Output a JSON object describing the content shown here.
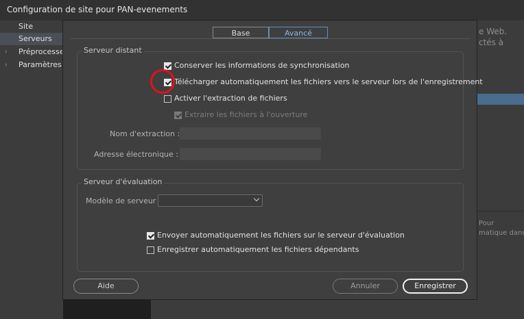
{
  "window": {
    "title": "Configuration de site pour PAN-evenements"
  },
  "outer_sidebar": {
    "items": [
      {
        "label": "Site",
        "selected": false,
        "expandable": false
      },
      {
        "label": "Serveurs",
        "selected": true,
        "expandable": false
      },
      {
        "label": "Préprocesse",
        "selected": false,
        "expandable": true
      },
      {
        "label": "Paramètres a",
        "selected": false,
        "expandable": true
      }
    ]
  },
  "outer_right": {
    "line1": "e Web.",
    "line2": "ctés à",
    "line3": "Pour",
    "line4": "matique dans"
  },
  "dialog": {
    "tabs": [
      {
        "label": "Base",
        "active": false
      },
      {
        "label": "Avancé",
        "active": true
      }
    ],
    "remote_server": {
      "title": "Serveur distant",
      "options": [
        {
          "label": "Conserver les informations de synchronisation",
          "checked": true,
          "disabled": false
        },
        {
          "label": "Télécharger automatiquement les fichiers vers le serveur lors de l'enregistrement",
          "checked": true,
          "disabled": false
        },
        {
          "label": "Activer l'extraction de fichiers",
          "checked": false,
          "disabled": false
        },
        {
          "label": "Extraire les fichiers à l'ouverture",
          "checked": true,
          "disabled": true
        }
      ],
      "extraction_name_label": "Nom d'extraction :",
      "extraction_name_value": "",
      "email_label": "Adresse électronique :",
      "email_value": ""
    },
    "testing_server": {
      "title": "Serveur d'évaluation",
      "model_label": "Modèle de serveur :",
      "model_value": "",
      "options": [
        {
          "label": "Envoyer automatiquement les fichiers sur le serveur d'évaluation",
          "checked": true
        },
        {
          "label": "Enregistrer automatiquement les fichiers dépendants",
          "checked": false
        }
      ]
    },
    "buttons": {
      "help": "Aide",
      "cancel": "Annuler",
      "save": "Enregistrer"
    }
  },
  "colors": {
    "annotation_circle": "#e1111a",
    "active_tab": "#89b7e4"
  }
}
